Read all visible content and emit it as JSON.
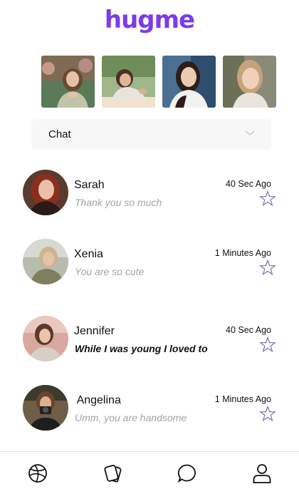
{
  "app": {
    "logo_text": "hugme",
    "brand_color": "#7c3aed",
    "star_color": "#7b6fb1"
  },
  "stories": [
    {
      "name": "story-1"
    },
    {
      "name": "story-2"
    },
    {
      "name": "story-3"
    },
    {
      "name": "story-4"
    }
  ],
  "filter": {
    "selected": "Chat",
    "icon": "chevron-down-icon"
  },
  "chats": [
    {
      "name": "Sarah",
      "message": "Thank you so much",
      "time": "40 Sec Ago",
      "unread": false
    },
    {
      "name": "Xenia",
      "message": "You are so cute",
      "time": "1 Minutes Ago",
      "unread": false
    },
    {
      "name": "Jennifer",
      "message": "While I was young I loved to",
      "time": "40 Sec Ago",
      "unread": true
    },
    {
      "name": " Angelina",
      "message": "Umm, you are handsome",
      "time": "1 Minutes Ago",
      "unread": false
    }
  ],
  "nav": {
    "items": [
      "globe-icon",
      "cards-icon",
      "chat-bubble-icon",
      "profile-icon"
    ]
  }
}
